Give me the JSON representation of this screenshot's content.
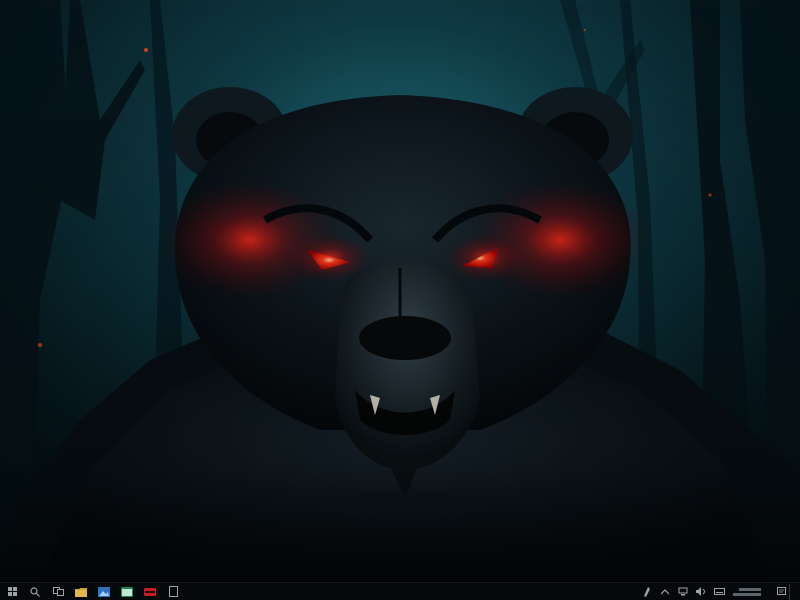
{
  "wallpaper": {
    "subject": "bear",
    "eye_color": "#ff2a1a",
    "background_color": "#0f3a44"
  },
  "taskbar": {
    "background": "#06090b",
    "pinned": [
      {
        "icon": "windows-start-icon"
      },
      {
        "icon": "search-icon"
      },
      {
        "icon": "task-view-icon"
      },
      {
        "icon": "file-explorer-icon"
      },
      {
        "icon": "image-viewer-icon"
      },
      {
        "icon": "browser-icon"
      },
      {
        "icon": "media-player-icon"
      },
      {
        "icon": "app-icon"
      }
    ],
    "tray": [
      {
        "icon": "pen-icon"
      },
      {
        "icon": "chevron-up-icon"
      },
      {
        "icon": "network-icon"
      },
      {
        "icon": "volume-icon"
      },
      {
        "icon": "keyboard-icon"
      }
    ]
  }
}
